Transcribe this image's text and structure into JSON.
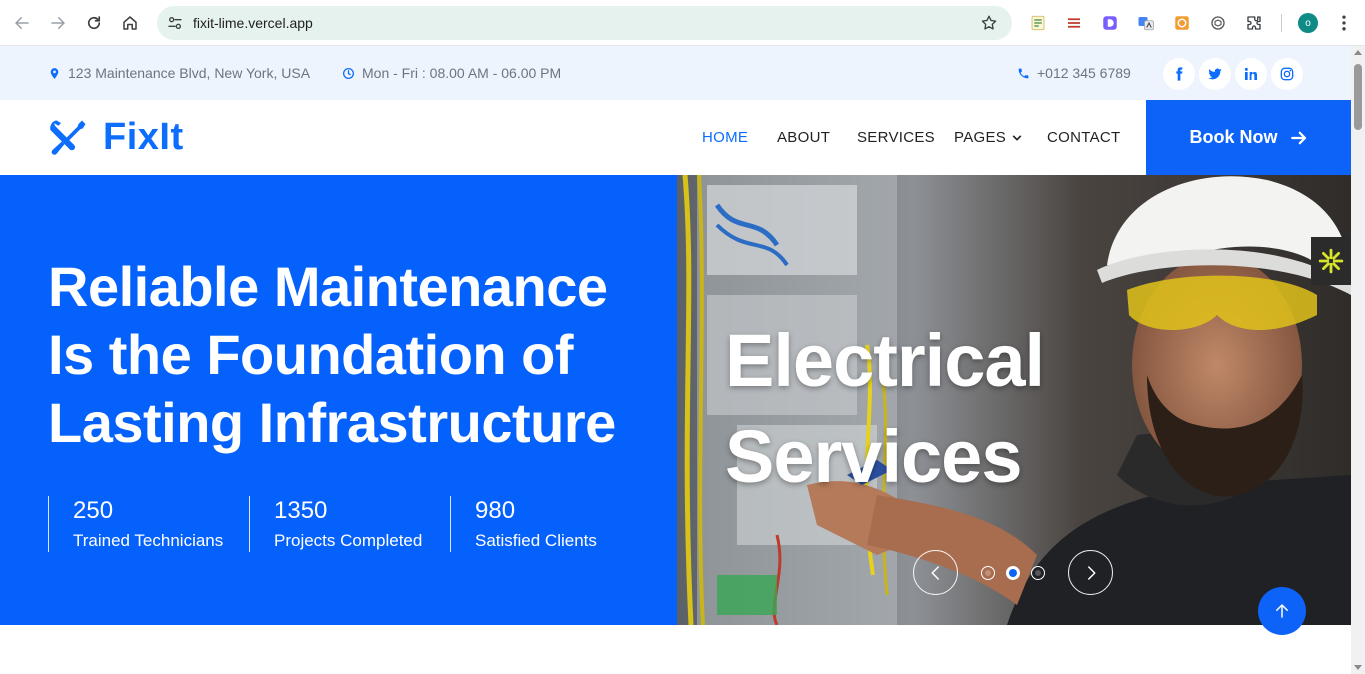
{
  "browser": {
    "url": "fixit-lime.vercel.app",
    "profile_initial": "o"
  },
  "topbar": {
    "address": "123 Maintenance Blvd, New York, USA",
    "hours": "Mon - Fri : 08.00 AM - 06.00 PM",
    "phone": "+012 345 6789",
    "socials": [
      "facebook-icon",
      "twitter-icon",
      "linkedin-icon",
      "instagram-icon"
    ]
  },
  "navbar": {
    "brand": "FixIt",
    "items": [
      {
        "label": "HOME",
        "active": true
      },
      {
        "label": "ABOUT"
      },
      {
        "label": "SERVICES"
      },
      {
        "label": "PAGES"
      },
      {
        "label": "CONTACT"
      }
    ],
    "cta": "Book Now"
  },
  "hero": {
    "title_lines": [
      "Reliable Maintenance",
      "Is the Foundation of",
      "Lasting Infrastructure"
    ],
    "stats": [
      {
        "value": "250",
        "label": "Trained Technicians"
      },
      {
        "value": "1350",
        "label": "Projects Completed"
      },
      {
        "value": "980",
        "label": "Satisfied Clients"
      }
    ],
    "slide": {
      "title_lines": [
        "Electrical",
        "Services"
      ],
      "current_index": 2,
      "total": 3
    }
  },
  "colors": {
    "brand_blue": "#0d63f8",
    "hero_blue": "#0561fc",
    "topbar_bg": "#eef4fe"
  }
}
